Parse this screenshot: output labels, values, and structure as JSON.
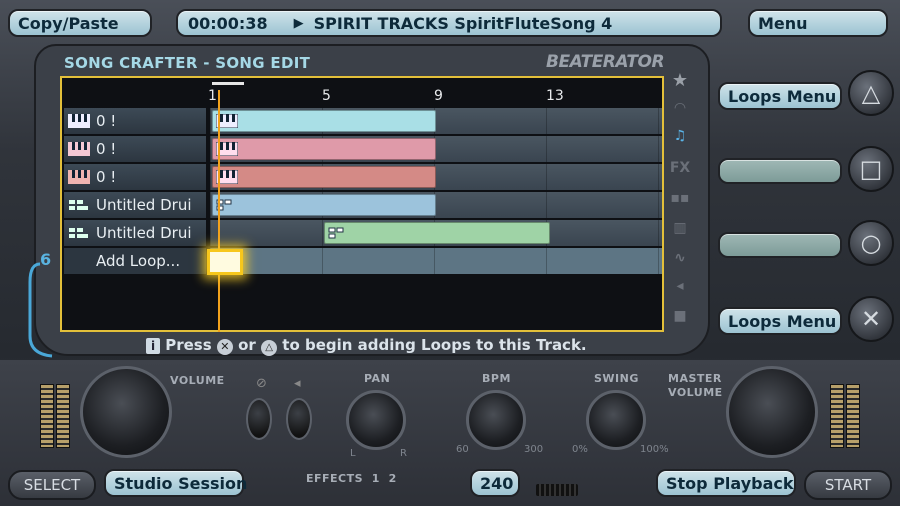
{
  "top_bar": {
    "copy_paste": "Copy/Paste",
    "time": "00:00:38",
    "song_title": "SPIRIT TRACKS SpiritFluteSong 4",
    "menu": "Menu"
  },
  "screen": {
    "title": "SONG CRAFTER - SONG EDIT",
    "brand": "BEATERATOR"
  },
  "ruler": [
    "1",
    "5",
    "9",
    "13"
  ],
  "tracks": [
    {
      "label": "0 !",
      "type": "synth",
      "loop_color": "#a9dfe6"
    },
    {
      "label": "0 !",
      "type": "synth",
      "loop_color": "#df9aa9"
    },
    {
      "label": "0 !",
      "type": "synth",
      "loop_color": "#d48a86"
    },
    {
      "label": "Untitled Drui",
      "type": "drum",
      "loop_color": "#9cc3dc"
    },
    {
      "label": "Untitled Drui",
      "type": "drum",
      "loop_color": "#9fd3a6"
    },
    {
      "label": "Add Loop...",
      "type": "add"
    }
  ],
  "track_number": "6",
  "hint": {
    "press": "Press",
    "or": "or",
    "rest": "to begin adding Loops to this Track."
  },
  "right_menu": {
    "top": "Loops Menu",
    "bottom": "Loops Menu"
  },
  "controls": {
    "volume": "VOLUME",
    "pan": "PAN",
    "pan_l": "L",
    "pan_r": "R",
    "bpm": "BPM",
    "bpm_min": "60",
    "bpm_max": "300",
    "swing": "SWING",
    "swing_min": "0%",
    "swing_max": "100%",
    "master_volume_1": "MASTER",
    "master_volume_2": "VOLUME",
    "effects": "EFFECTS",
    "effects_1": "1",
    "effects_2": "2"
  },
  "bottom_bar": {
    "select": "SELECT",
    "studio_session": "Studio Session",
    "bpm_value": "240",
    "stop_playback": "Stop Playback",
    "start": "START"
  }
}
